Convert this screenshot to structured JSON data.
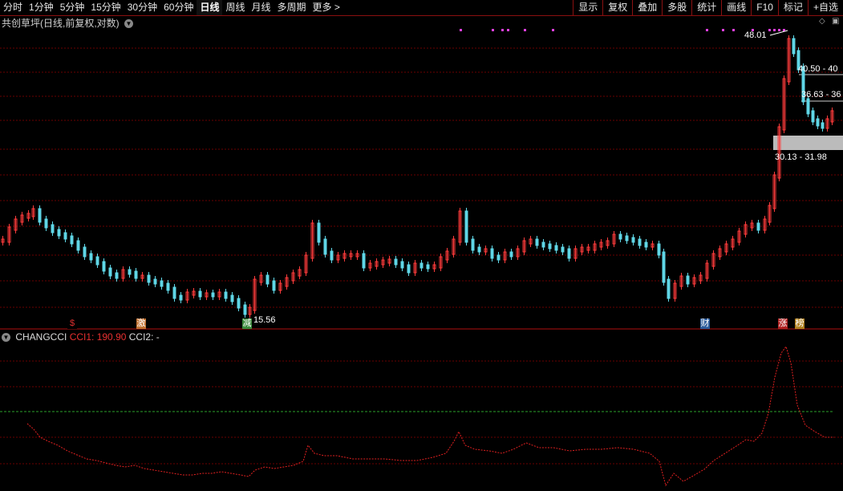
{
  "toolbar": {
    "periods": [
      "分时",
      "1分钟",
      "5分钟",
      "15分钟",
      "30分钟",
      "60分钟",
      "日线",
      "周线",
      "月线",
      "多周期",
      "更多 >"
    ],
    "active_period": "日线",
    "right_tools": [
      "显示",
      "复权",
      "叠加",
      "多股",
      "统计",
      "画线",
      "F10",
      "标记",
      "+自选"
    ]
  },
  "chart_title": "共创草坪(日线,前复权,对数)",
  "price_labels": {
    "high": "48.01",
    "box1": "40.50 - 40",
    "box2": "36.63 - 36",
    "box3": "30.13 - 31.98",
    "low": "15.56"
  },
  "markers": [
    {
      "text": "$",
      "color": "#e03030",
      "bg": "#000"
    },
    {
      "text": "激",
      "color": "#fff",
      "bg": "#c07030"
    },
    {
      "text": "减",
      "color": "#fff",
      "bg": "#3a8a3a"
    },
    {
      "text": "财",
      "color": "#fff",
      "bg": "#2a5a9a"
    },
    {
      "text": "涨",
      "color": "#fff",
      "bg": "#b02020"
    },
    {
      "text": "榜",
      "color": "#fff",
      "bg": "#b08020"
    }
  ],
  "indicator": {
    "name": "CHANGCCI",
    "cci1_label": "CCI1: 190.90",
    "cci2_label": "CCI2: -"
  },
  "colors": {
    "up": "#ff3b3b",
    "down": "#5fd6e6",
    "grid": "#6a0000",
    "divider": "#b01010",
    "cci_line": "#e02020",
    "zero_line": "#2aa02a",
    "signal": "#e040e0"
  }
}
